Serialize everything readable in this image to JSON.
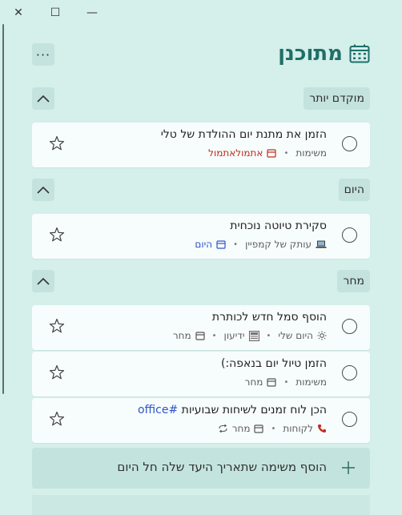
{
  "app": {
    "title": "מתוכנן"
  },
  "window_controls": {
    "close": "✕",
    "maximize": "☐",
    "minimize": "—"
  },
  "header": {
    "more_label": "···"
  },
  "sections": [
    {
      "label": "מוקדם יותר",
      "tasks": [
        {
          "title": "הזמן את מתנת יום ההולדת של טלי",
          "list": "משימות",
          "due": "אתמולאתמול",
          "due_color": "red"
        }
      ]
    },
    {
      "label": "היום",
      "tasks": [
        {
          "title": "סקירת טיוטה נוכחית",
          "list": "עותק של קמפיין",
          "due": "היום",
          "due_color": "blue"
        }
      ]
    },
    {
      "label": "מחר",
      "tasks": [
        {
          "title": "הוסף סמל חדש לכותרת",
          "list": "היום שלי",
          "list2": "ידיעון",
          "due": "מחר"
        },
        {
          "title": "הזמן טיול יום בנאפה:)",
          "list": "משימות",
          "due": "מחר"
        },
        {
          "title": "הכן לוח זמנים לשיחות שבועיות",
          "tag": "#office",
          "list": "לקוחות",
          "due": "מחר"
        }
      ]
    }
  ],
  "add_task": {
    "label": "הוסף משימה שתאריך היעד שלה חל היום"
  },
  "colors": {
    "background": "#d5efeb",
    "accent": "#1f6f68",
    "overdue": "#c42b1c",
    "today": "#2f54c7"
  }
}
